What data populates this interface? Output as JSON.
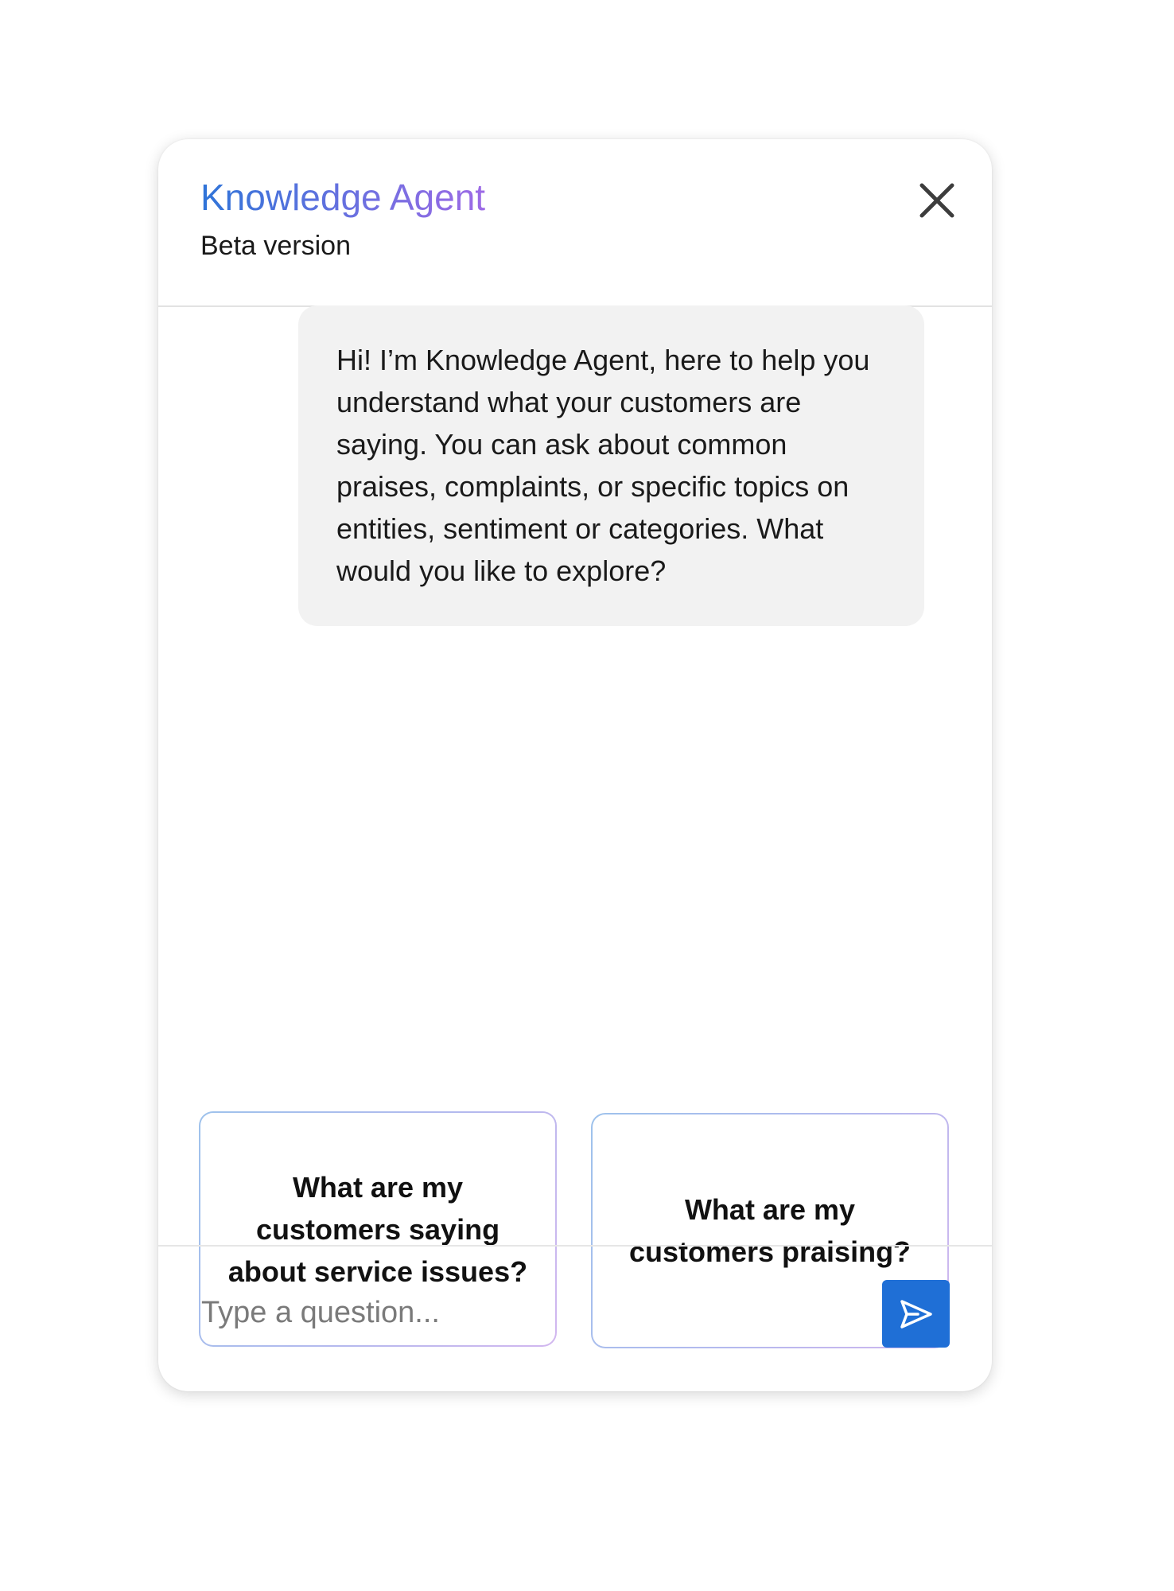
{
  "header": {
    "title": "Knowledge Agent",
    "subtitle": "Beta version",
    "close_icon": "close-icon"
  },
  "messages": [
    {
      "role": "agent",
      "text": "Hi! I’m Knowledge Agent, here to help you understand what your customers are saying. You can ask about common praises, complaints, or specific topics on entities, sentiment or categories. What would you like to explore?"
    }
  ],
  "suggestions": [
    {
      "label": "What are my customers saying about service issues?"
    },
    {
      "label": "What are my customers praising?"
    }
  ],
  "composer": {
    "placeholder": "Type a question...",
    "value": "",
    "send_icon": "send-icon"
  },
  "colors": {
    "accent": "#1f6fd6",
    "title_gradient_start": "#2f74d8",
    "title_gradient_end": "#9d6ae6",
    "bubble_background": "#f2f2f2"
  }
}
